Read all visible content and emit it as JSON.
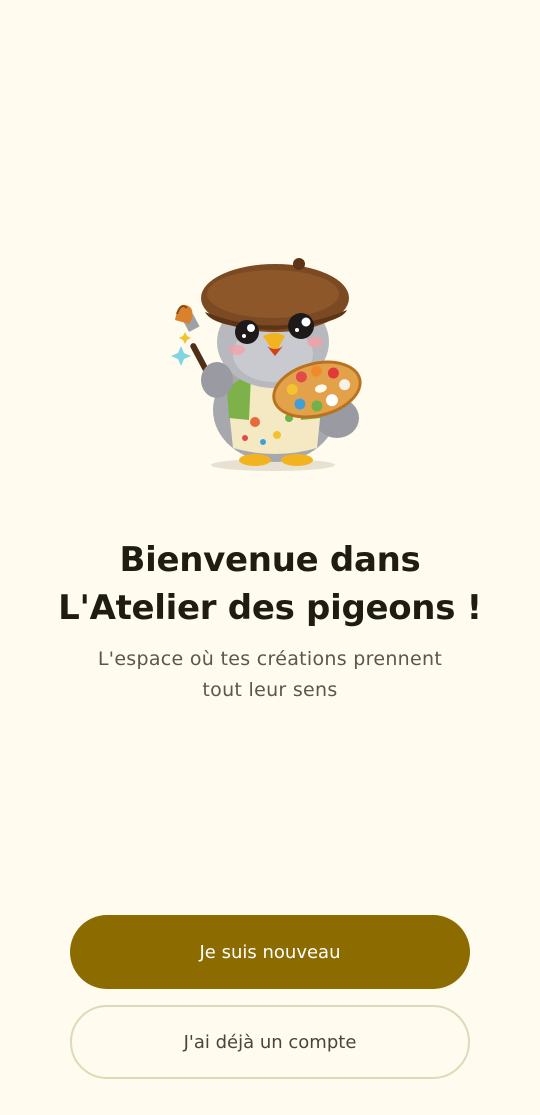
{
  "welcome": {
    "title_line1": "Bienvenue dans",
    "title_line2": "L'Atelier des pigeons !",
    "subtitle_line1": "L'espace où tes créations prennent",
    "subtitle_line2": "tout leur sens"
  },
  "actions": {
    "new_user_label": "Je suis nouveau",
    "existing_account_label": "J'ai déjà un compte"
  },
  "mascot": {
    "icon": "pigeon-painter-illustration"
  },
  "colors": {
    "background": "#FFFBEE",
    "primary_button": "#8C6C00",
    "title_text": "#1F1C12",
    "secondary_border": "#DEDAB9"
  }
}
